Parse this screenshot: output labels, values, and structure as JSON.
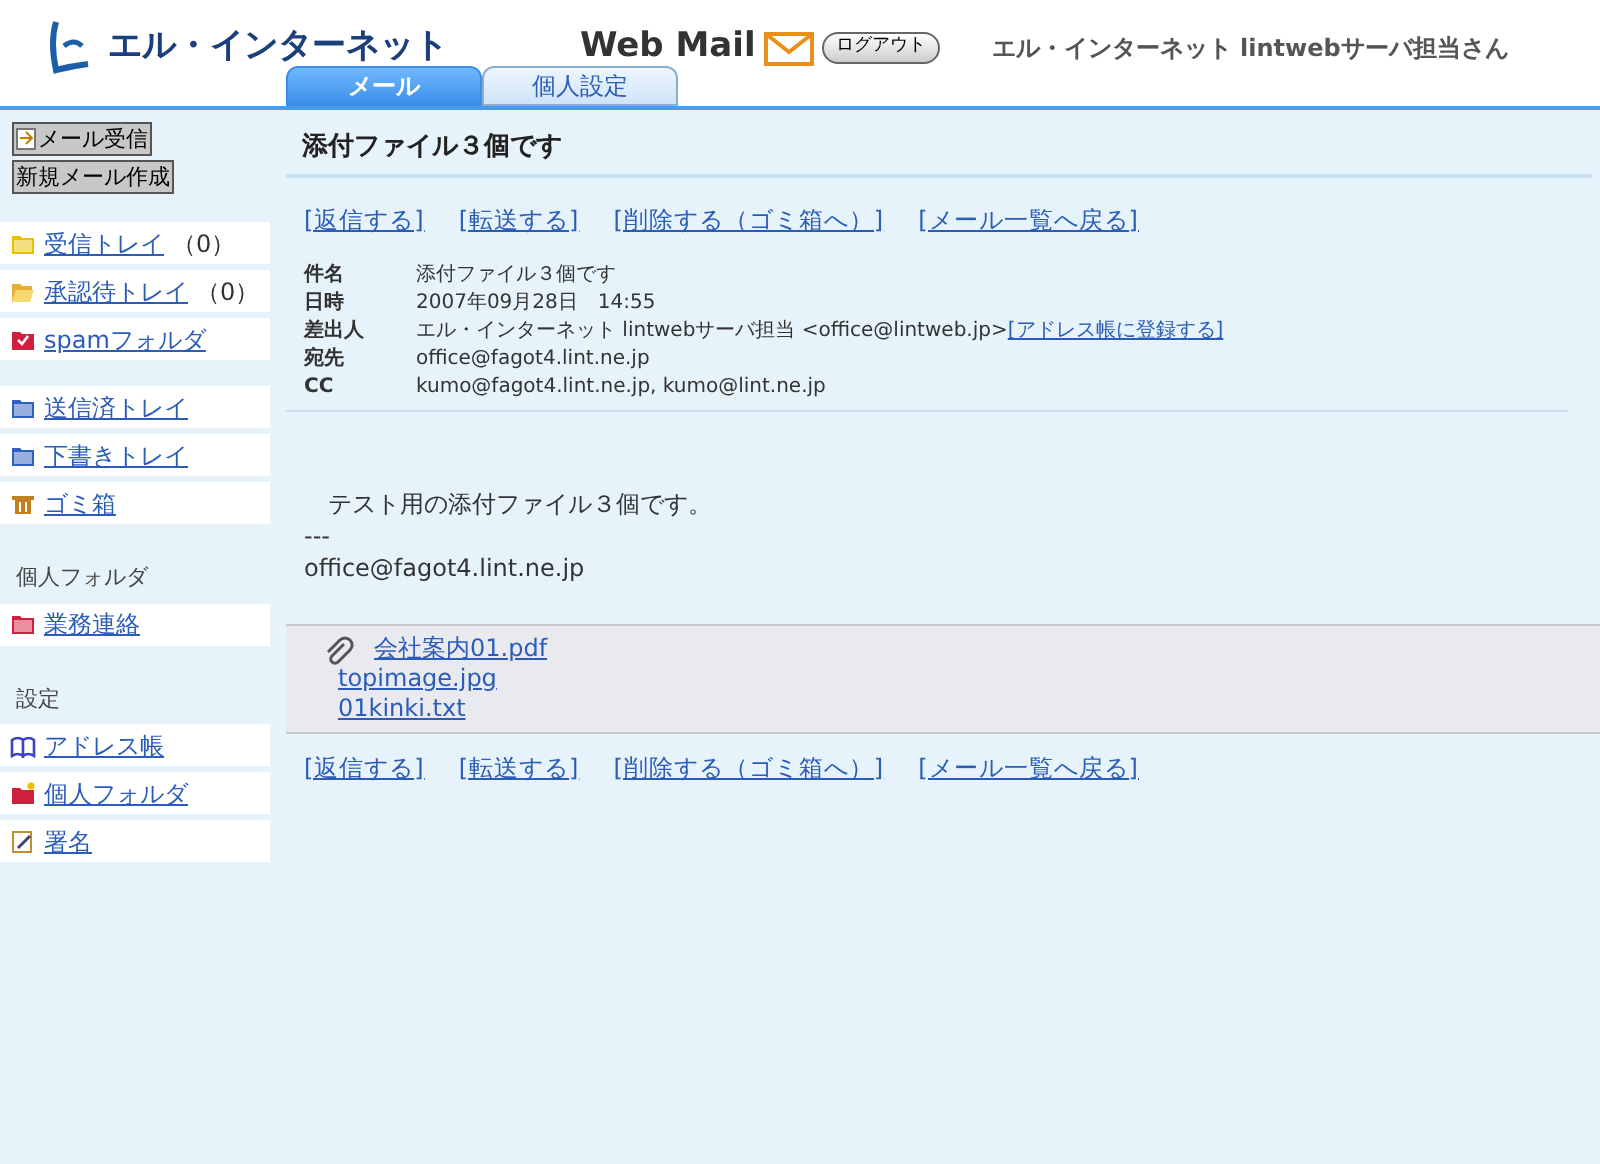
{
  "header": {
    "logo": "エル・インターネット",
    "app_title": "Web Mail",
    "logout": "ログアウト",
    "user": "エル・インターネット lintwebサーバ担当さん"
  },
  "tabs": [
    {
      "label": "メール",
      "selected": true
    },
    {
      "label": "個人設定",
      "selected": false
    }
  ],
  "sidebar": {
    "buttons": [
      {
        "label": "メール受信",
        "kind": "receive"
      },
      {
        "label": "新規メール作成",
        "kind": "plain"
      }
    ],
    "groups": [
      {
        "items": [
          {
            "label": "受信トレイ",
            "count": "（0）",
            "kind": "folder",
            "color": "#e8c000"
          },
          {
            "label": "承認待トレイ",
            "count": "（0）",
            "kind": "open-folder",
            "color": "#e8b030"
          },
          {
            "label": "spamフォルダ",
            "kind": "spam-folder",
            "color": "#d02040"
          }
        ]
      },
      {
        "items": [
          {
            "label": "送信済トレイ",
            "kind": "folder",
            "color": "#3060c0"
          },
          {
            "label": "下書きトレイ",
            "kind": "folder",
            "color": "#3060c0"
          },
          {
            "label": "ゴミ箱",
            "kind": "trash",
            "color": "#c08020"
          }
        ]
      },
      {
        "heading": "個人フォルダ",
        "items": [
          {
            "label": "業務連絡",
            "kind": "folder",
            "color": "#d02040"
          }
        ]
      },
      {
        "heading": "設定",
        "items": [
          {
            "label": "アドレス帳",
            "kind": "book",
            "color": "#4040c0"
          },
          {
            "label": "個人フォルダ",
            "kind": "new-folder",
            "color": "#d02040"
          },
          {
            "label": "署名",
            "kind": "note",
            "color": "#c09030"
          }
        ]
      }
    ]
  },
  "message": {
    "title": "添付ファイル３個です",
    "actions_top": [
      "[返信する]",
      "[転送する]",
      "[削除する（ゴミ箱へ）]",
      "[メール一覧へ戻る]"
    ],
    "fields": [
      {
        "label": "件名",
        "value": "添付ファイル３個です"
      },
      {
        "label": "日時",
        "value": "2007年09月28日　14:55"
      },
      {
        "label": "差出人",
        "value": "エル・インターネット lintwebサーバ担当 <office@lintweb.jp>",
        "link": "[アドレス帳に登録する]"
      },
      {
        "label": "宛先",
        "value": "office@fagot4.lint.ne.jp"
      },
      {
        "label": "CC",
        "value": "kumo@fagot4.lint.ne.jp, kumo@lint.ne.jp"
      }
    ],
    "body": [
      "　テスト用の添付ファイル３個です。",
      "---",
      "office@fagot4.lint.ne.jp"
    ],
    "attachments": [
      "会社案内01.pdf",
      "topimage.jpg",
      "01kinki.txt"
    ],
    "actions_bottom": [
      "[返信する]",
      "[転送する]",
      "[削除する（ゴミ箱へ）]",
      "[メール一覧へ戻る]"
    ]
  }
}
